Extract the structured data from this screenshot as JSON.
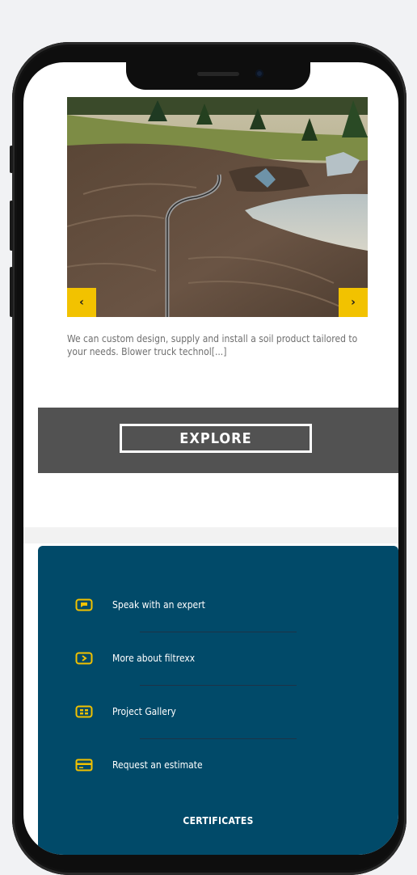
{
  "slider": {
    "prev_label": "‹",
    "next_label": "›",
    "description": "We can custom design, supply and install a soil product tailored to your needs. Blower truck technol[...]"
  },
  "cta": {
    "explore_label": "EXPLORE"
  },
  "links": [
    {
      "label": "Speak with an expert",
      "icon": "chat-bubble-icon"
    },
    {
      "label": "More about filtrexx",
      "icon": "arrow-box-icon"
    },
    {
      "label": "Project Gallery",
      "icon": "gallery-icon"
    },
    {
      "label": "Request an estimate",
      "icon": "credit-card-icon"
    }
  ],
  "footer": {
    "certificates_label": "CERTIFICATES"
  },
  "colors": {
    "accent": "#f2c200",
    "panel": "#014a69",
    "band": "#525252"
  }
}
